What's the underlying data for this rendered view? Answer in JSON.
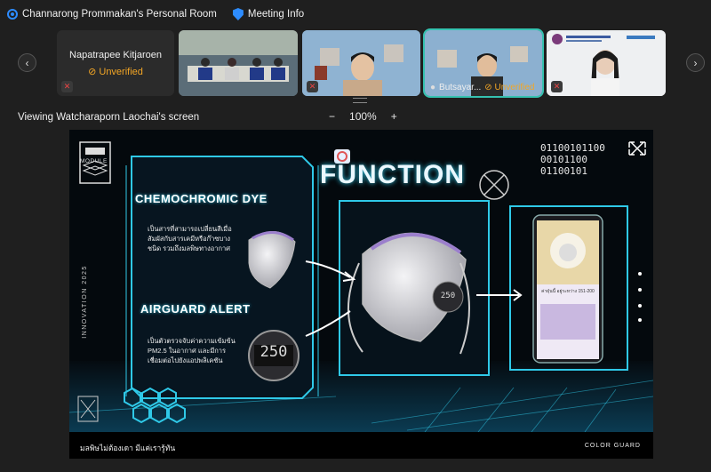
{
  "topbar": {
    "room": "Channarong Prommakan's Personal Room",
    "meeting_info": "Meeting Info"
  },
  "participants": [
    {
      "name": "Napatrapee Kitjaroen",
      "status": "Unverified"
    },
    {
      "name": ""
    },
    {
      "name": ""
    },
    {
      "name": "Butsayar...",
      "status": "Unverified"
    },
    {
      "name": ""
    }
  ],
  "share": {
    "title": "Viewing Watcharaporn Laochai's screen",
    "zoom": "100%",
    "minus": "−",
    "plus": "+"
  },
  "slide": {
    "module_label": "MODULE",
    "heading": "FUNCTION",
    "binary": [
      "01100101100",
      "00101100",
      "01100101"
    ],
    "chemo_title": "CHEMOCHROMIC DYE",
    "chemo_text": [
      "เป็นสารที่สามารถเปลี่ยนสีเมื่อ",
      "สัมผัสกับสารเคมีหรือก๊าซบาง",
      "ชนิด รวมถึงมลพิษทางอากาศ"
    ],
    "alert_title": "AIRGUARD ALERT",
    "alert_text": [
      "เป็นตัวตรวจจับค่าความเข้มข้น",
      "PM2.5 ในอากาศ และมีการ",
      "เชื่อมต่อไปยังแอปพลิเคชัน"
    ],
    "side_text": "INNOVATION 2025",
    "sensor_value": "250",
    "phone_caption": "ค่าฝุ่นนี้ อยู่ระหว่าง 151-200",
    "footer_left": "มลพิษไม่ต้องเดา มีแค่เรารู้ทัน",
    "footer_right": "COLOR GUARD"
  },
  "colors": {
    "accent": "#2d8cff",
    "warning": "#f3a625",
    "neon": "#2fc9e8",
    "active_border": "#35c2b0"
  }
}
